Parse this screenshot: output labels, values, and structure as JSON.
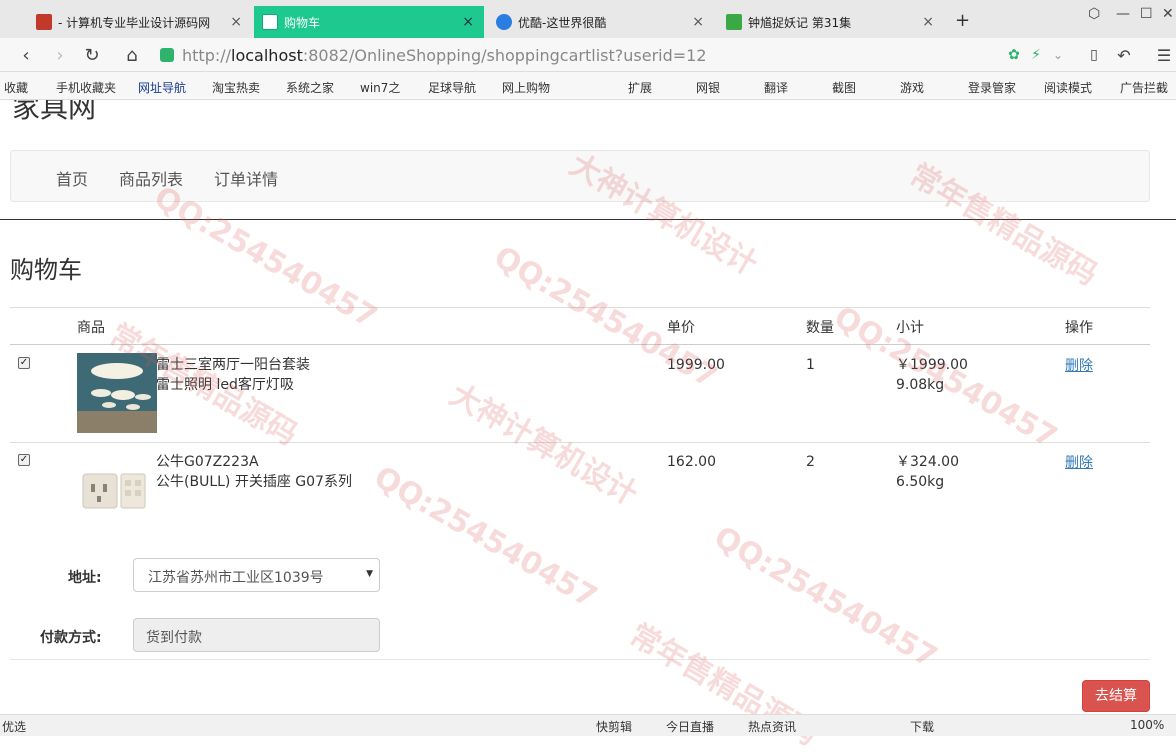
{
  "browser": {
    "tabs": [
      {
        "label": "- 计算机专业毕业设计源码网",
        "close": "×"
      },
      {
        "label": "购物车",
        "close": "×"
      },
      {
        "label": "优酷-这世界很酷",
        "close": "×"
      },
      {
        "label": "钟馗捉妖记 第31集",
        "close": "×"
      }
    ],
    "new_tab": "+",
    "url_prefix": "http://",
    "url_host": "localhost",
    "url_rest": ":8082/OnlineShopping/shoppingcartlist?userid=12",
    "bookmarks": [
      "收藏",
      "手机收藏夹",
      "网址导航",
      "淘宝热卖",
      "系统之家",
      "win7之",
      "足球导航",
      "网上购物",
      "扩展",
      "网银",
      "翻译",
      "截图",
      "游戏",
      "登录管家",
      "阅读模式",
      "广告拦截"
    ]
  },
  "site": {
    "brand": "家具网",
    "nav": [
      "首页",
      "商品列表",
      "订单详情"
    ]
  },
  "cart": {
    "title": "购物车",
    "columns": {
      "product": "商品",
      "price": "单价",
      "qty": "数量",
      "subtotal": "小计",
      "action": "操作"
    },
    "items": [
      {
        "name": "雷士三室两厅一阳台套装",
        "desc": "雷士照明 led客厅灯吸",
        "price": "1999.00",
        "qty": "1",
        "subtotal": "￥1999.00",
        "weight": "9.08kg",
        "delete": "删除",
        "checked": true
      },
      {
        "name": "公牛G07Z223A",
        "desc": "公牛(BULL) 开关插座 G07系列",
        "price": "162.00",
        "qty": "2",
        "subtotal": "￥324.00",
        "weight": "6.50kg",
        "delete": "删除",
        "checked": true
      }
    ],
    "address_label": "地址:",
    "address_value": "江苏省苏州市工业区1039号",
    "payment_label": "付款方式:",
    "payment_value": "货到付款",
    "checkout": "去结算"
  },
  "statusbar": {
    "left": "优选",
    "items": [
      "快剪辑",
      "今日直播",
      "热点资讯",
      "下载",
      "100%"
    ]
  },
  "watermark": [
    "QQ:254540457",
    "常年售精品源码",
    "大神计算机设计"
  ]
}
